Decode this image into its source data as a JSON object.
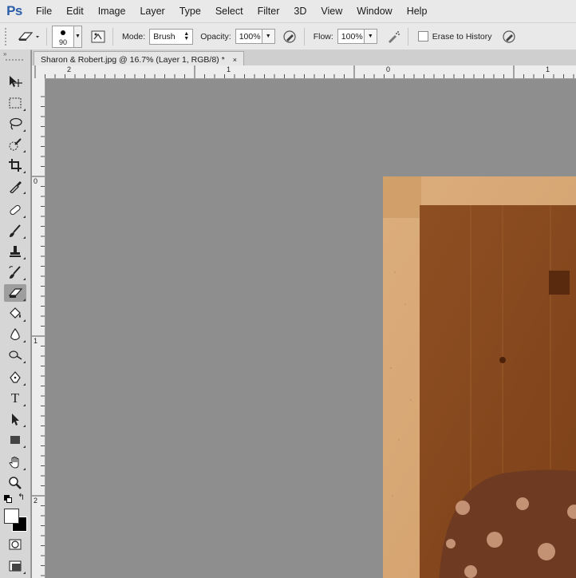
{
  "app": {
    "logo_text": "Ps"
  },
  "menu": {
    "items": [
      "File",
      "Edit",
      "Image",
      "Layer",
      "Type",
      "Select",
      "Filter",
      "3D",
      "View",
      "Window",
      "Help"
    ]
  },
  "options": {
    "brush_size": "90",
    "mode_label": "Mode:",
    "mode_value": "Brush",
    "opacity_label": "Opacity:",
    "opacity_value": "100%",
    "flow_label": "Flow:",
    "flow_value": "100%",
    "erase_to_history_label": "Erase to History"
  },
  "document": {
    "tab_title": "Sharon & Robert.jpg @ 16.7% (Layer 1, RGB/8) *",
    "close_glyph": "×"
  },
  "ruler_top": {
    "labels": [
      "2",
      "1",
      "0",
      "1"
    ]
  },
  "ruler_left": {
    "labels": [
      "0",
      "1",
      "2"
    ]
  },
  "tools": [
    {
      "name": "move-tool-icon"
    },
    {
      "name": "rectangular-marquee-tool-icon"
    },
    {
      "name": "lasso-tool-icon"
    },
    {
      "name": "quick-selection-tool-icon"
    },
    {
      "name": "crop-tool-icon"
    },
    {
      "name": "eyedropper-tool-icon"
    },
    {
      "name": "spot-healing-brush-tool-icon"
    },
    {
      "name": "brush-tool-icon"
    },
    {
      "name": "clone-stamp-tool-icon"
    },
    {
      "name": "history-brush-tool-icon"
    },
    {
      "name": "eraser-tool-icon",
      "active": true
    },
    {
      "name": "paint-bucket-tool-icon"
    },
    {
      "name": "blur-tool-icon"
    },
    {
      "name": "dodge-tool-icon"
    },
    {
      "name": "pen-tool-icon"
    },
    {
      "name": "type-tool-icon",
      "glyph": "T"
    },
    {
      "name": "path-selection-tool-icon"
    },
    {
      "name": "rectangle-tool-icon"
    },
    {
      "name": "hand-tool-icon"
    },
    {
      "name": "zoom-tool-icon"
    }
  ],
  "colors": {
    "foreground": "#ffffff",
    "background": "#000000",
    "photo_border": "#d8a874",
    "photo_inner": "#8a4a1c"
  }
}
